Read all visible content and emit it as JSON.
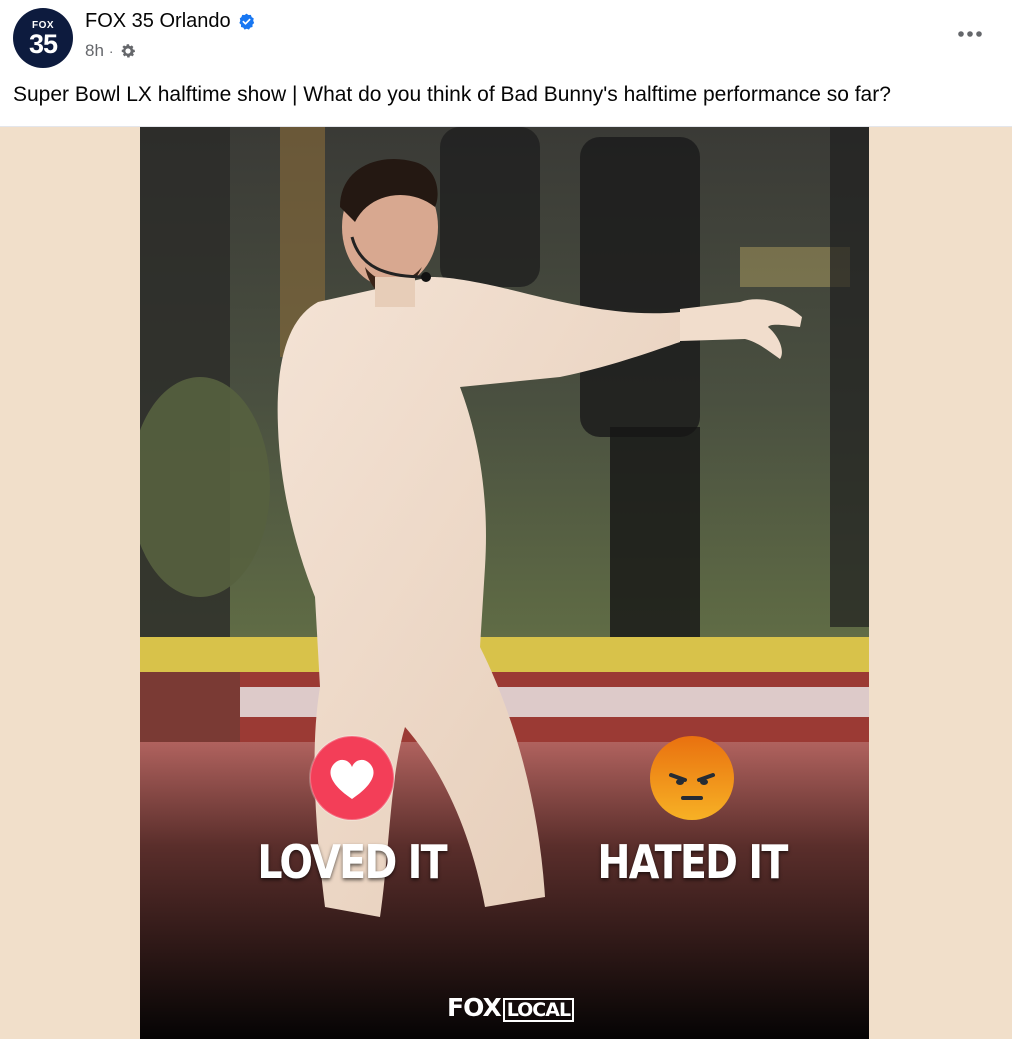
{
  "post": {
    "page_name": "FOX 35 Orlando",
    "avatar_top": "FOX",
    "avatar_number": "35",
    "time": "8h",
    "separator": "·",
    "caption": "Super Bowl LX halftime show | What do you think of Bad Bunny's halftime performance so far?",
    "icons": {
      "verified": "verified-badge-icon",
      "audience": "gear-icon",
      "more": "more-options-icon"
    }
  },
  "image": {
    "poll": [
      {
        "label": "LOVED IT",
        "icon": "love-reaction-icon"
      },
      {
        "label": "HATED IT",
        "icon": "angry-reaction-icon"
      }
    ],
    "brand_fox": "FOX",
    "brand_local": "LOCAL"
  },
  "colors": {
    "verified": "#1877f2",
    "love": "#f33e58",
    "angry": "#f7b125",
    "media_background": "#f1dfca",
    "avatar": "#0d1b3e"
  }
}
